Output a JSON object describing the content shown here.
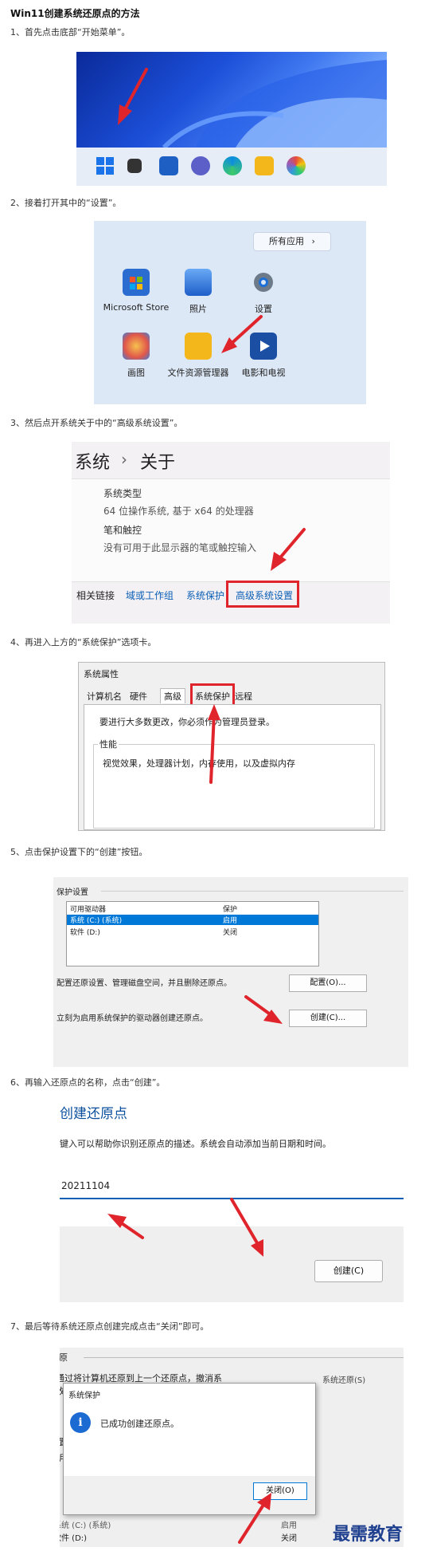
{
  "title": "Win11创建系统还原点的方法",
  "steps": [
    "1、首先点击底部“开始菜单”。",
    "2、接着打开其中的“设置”。",
    "3、然后点开系统关于中的“高级系统设置”。",
    "4、再进入上方的“系统保护”选项卡。",
    "5、点击保护设置下的“创建”按钮。",
    "6、再输入还原点的名称，点击“创建”。",
    "7、最后等待系统还原点创建完成点击“关闭”即可。"
  ],
  "shot2": {
    "all_apps": "所有应用",
    "all_apps_chevron": "›",
    "apps": [
      "Microsoft Store",
      "照片",
      "设置",
      "画图",
      "文件资源管理器",
      "电影和电视"
    ]
  },
  "shot3": {
    "breadcrumb_root": "系统",
    "breadcrumb_sep": "›",
    "breadcrumb_page": "关于",
    "row1_label": "系统类型",
    "row1_value": "64 位操作系统, 基于 x64 的处理器",
    "row2_label": "笔和触控",
    "row2_value": "没有可用于此显示器的笔或触控输入",
    "links_label": "相关链接",
    "links": [
      "域或工作组",
      "系统保护",
      "高级系统设置"
    ]
  },
  "shot4": {
    "window_title": "系统属性",
    "tabs": [
      "计算机名",
      "硬件",
      "高级",
      "系统保护",
      "远程"
    ],
    "notice": "要进行大多数更改，你必须作为管理员登录。",
    "group_label": "性能",
    "group_text": "视觉效果，处理器计划，内存使用，以及虚拟内存"
  },
  "shot5": {
    "group_label": "保护设置",
    "col_drive": "可用驱动器",
    "col_protect": "保护",
    "rows": [
      {
        "drive": "系统 (C:) (系统)",
        "status": "启用"
      },
      {
        "drive": "软件 (D:)",
        "status": "关闭"
      }
    ],
    "config_text": "配置还原设置、管理磁盘空间，并且删除还原点。",
    "config_button": "配置(O)...",
    "create_text": "立刻为启用系统保护的驱动器创建还原点。",
    "create_button": "创建(C)..."
  },
  "shot6": {
    "heading": "创建还原点",
    "desc": "键入可以帮助你识别还原点的描述。系统会自动添加当前日期和时间。",
    "input_value": "20211104",
    "create_button": "创建(C)"
  },
  "shot7": {
    "bg_title": "还原",
    "bg_text1": "以通过将计算机还原到上一个还原点，撤消系",
    "bg_text2": "更改。",
    "bg_right": "系统还原(S)",
    "bg_group": "设置",
    "bg_col": "可用",
    "bg_row1": "系统 (C:) (系统)",
    "bg_row1_status": "启用",
    "bg_row2": "软件 (D:)",
    "bg_row2_status": "关闭",
    "dialog_title": "系统保护",
    "dialog_icon": "i",
    "dialog_message": "已成功创建还原点。",
    "close_button": "关闭(O)"
  },
  "watermark": "最需教育",
  "colors": {
    "arrow": "#e0242c",
    "accent": "#0a5fb5",
    "selection": "#0078d7"
  }
}
